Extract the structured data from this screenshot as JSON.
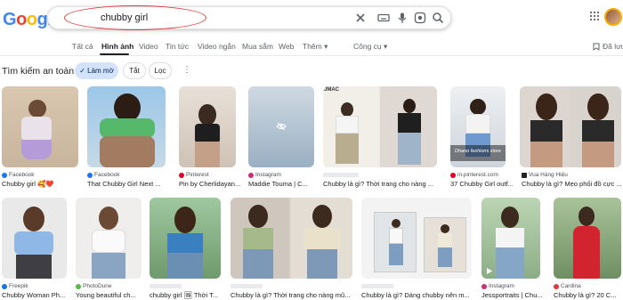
{
  "logo": [
    "G",
    "o",
    "o",
    "g",
    "l",
    "e"
  ],
  "logo_colors": [
    "#4285f4",
    "#ea4335",
    "#fbbc05",
    "#4285f4",
    "#34a853",
    "#ea4335"
  ],
  "search": {
    "query": "chubby girl"
  },
  "tabs": [
    "Tất cả",
    "Hình ảnh",
    "Video",
    "Tin tức",
    "Video ngắn",
    "Mua sắm",
    "Web",
    "Thêm ▾",
    "Công cụ ▾"
  ],
  "saved_label": "Đã lưu",
  "filters": {
    "safe_search": "Tìm kiếm an toàn",
    "chips": [
      "✓ Làm mờ",
      "Tắt",
      "Lọc"
    ]
  },
  "row1": [
    {
      "source": "Facebook",
      "title": "Chubby girl 🥰❤️"
    },
    {
      "source": "Facebook",
      "title": "That Chubby Girl Next ..."
    },
    {
      "source": "Pinterest",
      "title": "Pin by Cherlidayan..."
    },
    {
      "source": "Instagram",
      "title": "Maddie Touma | C..."
    },
    {
      "source": "",
      "title": "Chubby là gì? Thời trang cho nàng ..."
    },
    {
      "source": "in.pinterest.com",
      "title": "37 Chubby Girl outf..."
    },
    {
      "source": "Vua Hàng Hiệu",
      "title": "Chubby là gì? Mẹo phối đồ cực ..."
    }
  ],
  "row2": [
    {
      "source": "Freepik",
      "title": "Chubby Woman Ph..."
    },
    {
      "source": "PhotoDune",
      "title": "Young beautiful ch..."
    },
    {
      "source": "",
      "title": "chubby girl 🖼 Thời T..."
    },
    {
      "source": "",
      "title": "Chubby là gì? Thời trang cho nàng mũ..."
    },
    {
      "source": "",
      "title": "Chubby là gì? Dáng chubby nên m..."
    },
    {
      "source": "Instagram",
      "title": "Jessportraits | Chu..."
    },
    {
      "source": "Cardina",
      "title": "Chubby là gì? 20 C..."
    }
  ],
  "overlay_text": "Dhano fashions store"
}
